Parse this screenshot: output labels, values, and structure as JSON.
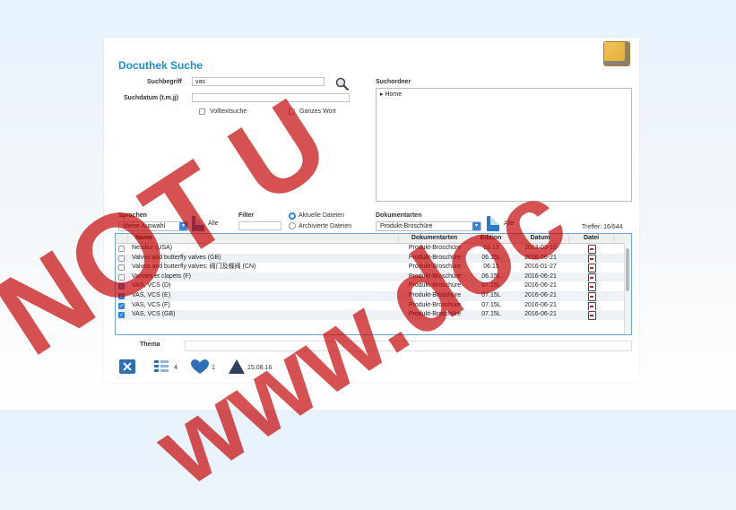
{
  "app": {
    "title": "Docuthek Suche"
  },
  "search": {
    "term_label": "Suchbegriff",
    "term_value": "vas",
    "date_label": "Suchdatum (t.m.jj)",
    "date_value": "",
    "fulltext_label": "Volltextsuche",
    "fulltext_checked": false,
    "wholeword_label": "Ganzes Wort",
    "wholeword_checked": false
  },
  "folders": {
    "label": "Suchordner",
    "items": [
      "▸ Home"
    ]
  },
  "filters": {
    "language_label": "Sprachen",
    "language_value": "Meine Auswahl",
    "all_label": "Alle",
    "filter_label": "Filter",
    "filter_value": "",
    "current_docs_label": "Aktuelle Dateien",
    "archived_docs_label": "Archivierte Dateien",
    "current_selected": true,
    "doctypes_label": "Dokumentarten",
    "doctypes_value": "Produkt-Broschüre",
    "doctypes_all_label": "Alle",
    "hits_label": "Treffer: 16/644"
  },
  "table": {
    "headers": [
      "Name",
      "Dokumentarten",
      "Edition",
      "Datum",
      "Datei"
    ],
    "rows": [
      {
        "checked": false,
        "name": "Nesdiur (USA)",
        "type": "Produkt-Broschüre",
        "edition": "03.13",
        "date": "2013-03-19"
      },
      {
        "checked": false,
        "name": "Valves and butterfly valves (GB)",
        "type": "Produkt-Broschüre",
        "edition": "06.15L",
        "date": "2016-06-21"
      },
      {
        "checked": false,
        "name": "Valves and butterfly valves; 阀门及蝶阀 (CN)",
        "type": "Produkt-Broschüre",
        "edition": "06.15",
        "date": "2016-01-27"
      },
      {
        "checked": false,
        "name": "Vannes et clapets (F)",
        "type": "Produkt-Broschüre",
        "edition": "06.15L",
        "date": "2016-06-21"
      },
      {
        "checked": true,
        "name": "VAS, VCS (D)",
        "type": "Produkt-Broschüre",
        "edition": "07.15L",
        "date": "2016-06-21"
      },
      {
        "checked": true,
        "name": "VAS, VCS (E)",
        "type": "Produkt-Broschüre",
        "edition": "07.15L",
        "date": "2016-06-21"
      },
      {
        "checked": true,
        "name": "VAS, VCS (F)",
        "type": "Produkt-Broschüre",
        "edition": "07.15L",
        "date": "2016-06-21"
      },
      {
        "checked": true,
        "name": "VAS, VCS (GB)",
        "type": "Produkt-Broschüre",
        "edition": "07.15L",
        "date": "2016-06-21"
      }
    ]
  },
  "thema": {
    "label": "Thema"
  },
  "footer": {
    "list_count": "4",
    "fav_count": "1",
    "date": "15.08.16"
  },
  "watermark": {
    "line1": "NOT U",
    "line2": "www.doc"
  },
  "colors": {
    "title_blue": "#1b8fd1",
    "accent_blue": "#2f82e0",
    "watermark_red": "#c40000"
  }
}
